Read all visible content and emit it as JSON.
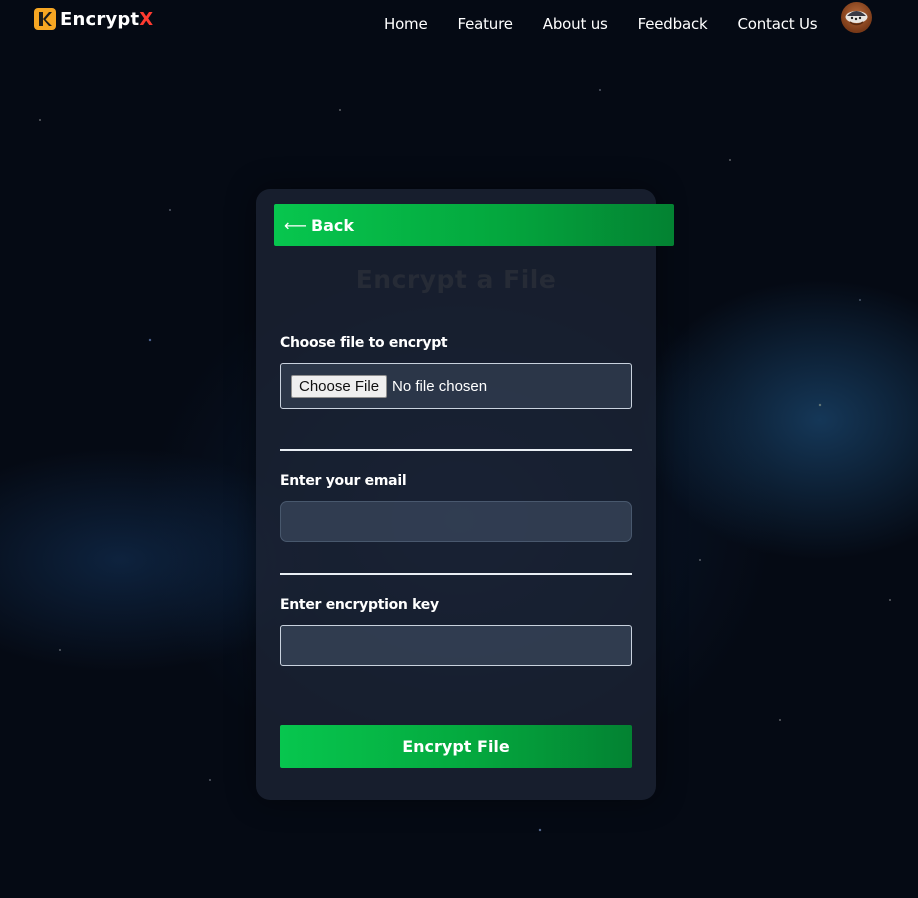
{
  "navbar": {
    "logo": {
      "text_main": "Encrypt",
      "text_accent": "X",
      "icon": "logo-x-icon",
      "colors": {
        "mark": "#f6a623",
        "accent": "#ff3b30"
      }
    },
    "links": [
      {
        "label": "Home"
      },
      {
        "label": "Feature"
      },
      {
        "label": "About us"
      },
      {
        "label": "Feedback"
      },
      {
        "label": "Contact Us"
      }
    ],
    "avatar_icon": "user-avatar-icon"
  },
  "card": {
    "back_label": "Back",
    "back_icon": "arrow-left-icon",
    "title": "Encrypt a File",
    "file_field": {
      "label": "Choose file to encrypt",
      "button_label": "Choose File",
      "status": "No file chosen"
    },
    "email_field": {
      "label": "Enter your email",
      "value": "",
      "placeholder": ""
    },
    "key_field": {
      "label": "Enter encryption key",
      "value": "",
      "placeholder": ""
    },
    "submit_label": "Encrypt File",
    "colors": {
      "button_green": "#07c64e",
      "button_green_dark": "#038232",
      "title": "#262b36"
    }
  }
}
